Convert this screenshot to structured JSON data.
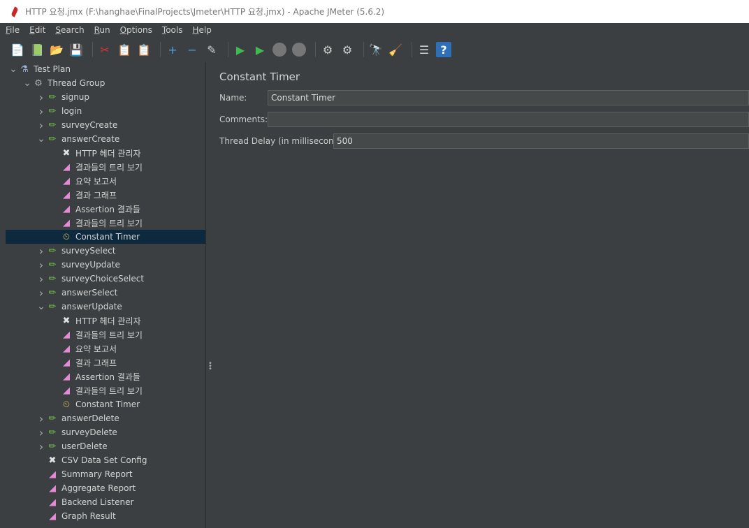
{
  "window": {
    "title": "HTTP 요청.jmx (F:\\hanghae\\FinalProjects\\Jmeter\\HTTP 요청.jmx) - Apache JMeter (5.6.2)"
  },
  "menu": [
    "File",
    "Edit",
    "Search",
    "Run",
    "Options",
    "Tools",
    "Help"
  ],
  "toolbar": [
    {
      "name": "new-icon",
      "glyph": "📄"
    },
    {
      "name": "templates-icon",
      "glyph": "📗"
    },
    {
      "name": "open-icon",
      "glyph": "📂"
    },
    {
      "name": "save-icon",
      "glyph": "💾"
    },
    {
      "name": "cut-icon",
      "glyph": "✂"
    },
    {
      "name": "copy-icon",
      "glyph": "📋"
    },
    {
      "name": "paste-icon",
      "glyph": "📋"
    },
    {
      "name": "expand-icon",
      "glyph": "+"
    },
    {
      "name": "collapse-icon",
      "glyph": "−"
    },
    {
      "name": "toggle-icon",
      "glyph": "✎"
    },
    {
      "name": "start-icon",
      "glyph": "▶"
    },
    {
      "name": "start-no-pause-icon",
      "glyph": "▶"
    },
    {
      "name": "stop-icon",
      "glyph": ""
    },
    {
      "name": "shutdown-icon",
      "glyph": ""
    },
    {
      "name": "clear-icon",
      "glyph": "⚙"
    },
    {
      "name": "clear-all-icon",
      "glyph": "⚙"
    },
    {
      "name": "search-icon",
      "glyph": "🔭"
    },
    {
      "name": "reset-search-icon",
      "glyph": "🧹"
    },
    {
      "name": "function-helper-icon",
      "glyph": "☰"
    },
    {
      "name": "help-icon",
      "glyph": "?"
    }
  ],
  "tree": [
    {
      "label": "Test Plan",
      "indent": 0,
      "chev": "v",
      "icon": "flask-icon",
      "glyph": "⚗"
    },
    {
      "label": "Thread Group",
      "indent": 1,
      "chev": "v",
      "icon": "gear-icon",
      "glyph": "⚙"
    },
    {
      "label": "signup",
      "indent": 2,
      "chev": ">",
      "icon": "sampler-icon",
      "glyph": "✏"
    },
    {
      "label": "login",
      "indent": 2,
      "chev": ">",
      "icon": "sampler-icon",
      "glyph": "✏"
    },
    {
      "label": "surveyCreate",
      "indent": 2,
      "chev": ">",
      "icon": "sampler-icon",
      "glyph": "✏"
    },
    {
      "label": "answerCreate",
      "indent": 2,
      "chev": "v",
      "icon": "sampler-icon",
      "glyph": "✏"
    },
    {
      "label": "HTTP 헤더 관리자",
      "indent": 3,
      "chev": "",
      "icon": "tools-icon",
      "glyph": "✖"
    },
    {
      "label": "결과들의 트리 보기",
      "indent": 3,
      "chev": "",
      "icon": "chart-icon",
      "glyph": "◢"
    },
    {
      "label": "요약 보고서",
      "indent": 3,
      "chev": "",
      "icon": "chart-icon",
      "glyph": "◢"
    },
    {
      "label": "결과 그래프",
      "indent": 3,
      "chev": "",
      "icon": "chart-icon",
      "glyph": "◢"
    },
    {
      "label": "Assertion 결과들",
      "indent": 3,
      "chev": "",
      "icon": "chart-icon",
      "glyph": "◢"
    },
    {
      "label": "결과들의 트리 보기",
      "indent": 3,
      "chev": "",
      "icon": "chart-icon",
      "glyph": "◢"
    },
    {
      "label": "Constant Timer",
      "indent": 3,
      "chev": "",
      "icon": "timer-icon",
      "glyph": "⏲",
      "selected": true
    },
    {
      "label": "surveySelect",
      "indent": 2,
      "chev": ">",
      "icon": "sampler-icon",
      "glyph": "✏"
    },
    {
      "label": "surveyUpdate",
      "indent": 2,
      "chev": ">",
      "icon": "sampler-icon",
      "glyph": "✏"
    },
    {
      "label": "surveyChoiceSelect",
      "indent": 2,
      "chev": ">",
      "icon": "sampler-icon",
      "glyph": "✏"
    },
    {
      "label": "answerSelect",
      "indent": 2,
      "chev": ">",
      "icon": "sampler-icon",
      "glyph": "✏"
    },
    {
      "label": "answerUpdate",
      "indent": 2,
      "chev": "v",
      "icon": "sampler-icon",
      "glyph": "✏"
    },
    {
      "label": "HTTP 헤더 관리자",
      "indent": 3,
      "chev": "",
      "icon": "tools-icon",
      "glyph": "✖"
    },
    {
      "label": "결과들의 트리 보기",
      "indent": 3,
      "chev": "",
      "icon": "chart-icon",
      "glyph": "◢"
    },
    {
      "label": "요약 보고서",
      "indent": 3,
      "chev": "",
      "icon": "chart-icon",
      "glyph": "◢"
    },
    {
      "label": "결과 그래프",
      "indent": 3,
      "chev": "",
      "icon": "chart-icon",
      "glyph": "◢"
    },
    {
      "label": "Assertion 결과들",
      "indent": 3,
      "chev": "",
      "icon": "chart-icon",
      "glyph": "◢"
    },
    {
      "label": "결과들의 트리 보기",
      "indent": 3,
      "chev": "",
      "icon": "chart-icon",
      "glyph": "◢"
    },
    {
      "label": "Constant Timer",
      "indent": 3,
      "chev": "",
      "icon": "timer-icon",
      "glyph": "⏲"
    },
    {
      "label": "answerDelete",
      "indent": 2,
      "chev": ">",
      "icon": "sampler-icon",
      "glyph": "✏"
    },
    {
      "label": "surveyDelete",
      "indent": 2,
      "chev": ">",
      "icon": "sampler-icon",
      "glyph": "✏"
    },
    {
      "label": "userDelete",
      "indent": 2,
      "chev": ">",
      "icon": "sampler-icon",
      "glyph": "✏"
    },
    {
      "label": "CSV Data Set Config",
      "indent": 2,
      "chev": "",
      "icon": "tools-icon",
      "glyph": "✖"
    },
    {
      "label": "Summary Report",
      "indent": 2,
      "chev": "",
      "icon": "chart-icon",
      "glyph": "◢"
    },
    {
      "label": "Aggregate Report",
      "indent": 2,
      "chev": "",
      "icon": "chart-icon",
      "glyph": "◢"
    },
    {
      "label": "Backend Listener",
      "indent": 2,
      "chev": "",
      "icon": "chart-icon",
      "glyph": "◢"
    },
    {
      "label": "Graph Result",
      "indent": 2,
      "chev": "",
      "icon": "chart-icon",
      "glyph": "◢"
    }
  ],
  "panel": {
    "title": "Constant Timer",
    "name_label": "Name:",
    "name_value": "Constant Timer",
    "comments_label": "Comments:",
    "comments_value": "",
    "delay_label": "Thread Delay (in milliseconds):",
    "delay_value": "500"
  }
}
